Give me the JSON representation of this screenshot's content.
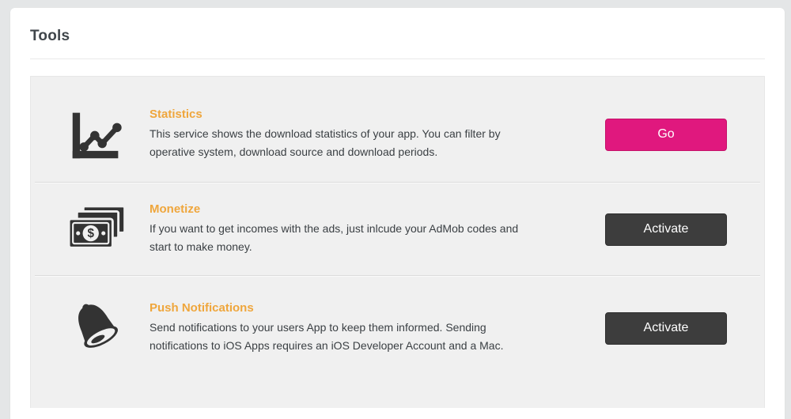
{
  "page": {
    "title": "Tools"
  },
  "colors": {
    "accent_orange": "#efa63c",
    "go_button_pink": "#e0187e",
    "activate_button_dark": "#3d3d3d",
    "icon_dark": "#333333",
    "panel_gray": "#f0f0f0"
  },
  "tools": [
    {
      "id": "statistics",
      "icon": "line-chart-icon",
      "title": "Statistics",
      "description": "This service shows the download statistics of your app. You can filter by\noperative system, download source and download periods.",
      "button_label": "Go"
    },
    {
      "id": "monetize",
      "icon": "money-icon",
      "title": "Monetize",
      "description": "If you want to get incomes with the ads, just inlcude your AdMob codes and\nstart to make money.",
      "button_label": "Activate"
    },
    {
      "id": "push-notifications",
      "icon": "bell-icon",
      "title": "Push Notifications",
      "description": "Send notifications to your users App to keep them informed. Sending\nnotifications to iOS Apps requires an iOS Developer Account and a Mac.",
      "button_label": "Activate"
    }
  ]
}
